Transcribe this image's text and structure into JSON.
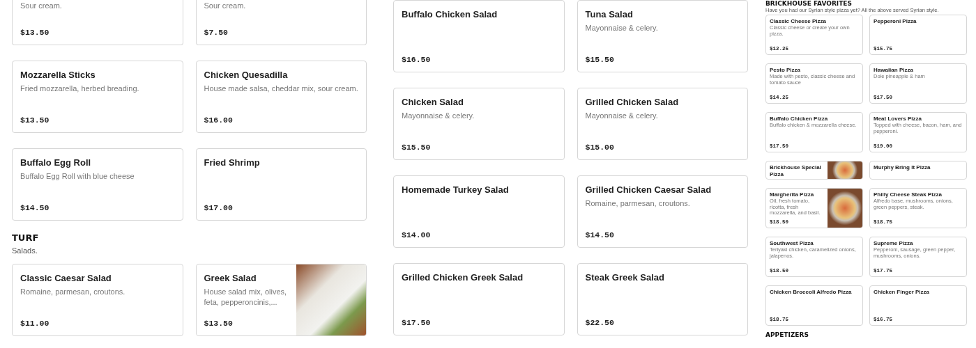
{
  "panels": [
    {
      "blocks": [
        {
          "kind": "grid",
          "items": [
            {
              "kind": "partial",
              "description": "Sour cream.",
              "price": "$13.50"
            },
            {
              "kind": "partial",
              "description": "Sour cream.",
              "price": "$7.50"
            },
            {
              "kind": "full",
              "name": "Mozzarella Sticks",
              "description": "Fried mozzarella, herbed breading.",
              "price": "$13.50"
            },
            {
              "kind": "full",
              "name": "Chicken Quesadilla",
              "description": "House made salsa, cheddar mix, sour cream.",
              "price": "$16.00"
            },
            {
              "kind": "full",
              "name": "Buffalo Egg Roll",
              "description": "Buffalo Egg Roll with blue cheese",
              "price": "$14.50"
            },
            {
              "kind": "full",
              "name": "Fried Shrimp",
              "price": "$17.00"
            }
          ]
        },
        {
          "kind": "heading",
          "title": "TURF",
          "subtitle": "Salads."
        },
        {
          "kind": "grid",
          "items": [
            {
              "kind": "full",
              "name": "Classic Caesar Salad",
              "description": "Romaine, parmesan, croutons.",
              "price": "$11.00"
            },
            {
              "kind": "full",
              "name": "Greek Salad",
              "description": "House salad mix, olives, feta, pepperoncinis,...",
              "price": "$13.50",
              "photo": true
            }
          ]
        }
      ]
    },
    {
      "blocks": [
        {
          "kind": "grid",
          "items": [
            {
              "kind": "full",
              "name": "Buffalo Chicken Salad",
              "price": "$16.50"
            },
            {
              "kind": "full",
              "name": "Tuna Salad",
              "description": "Mayonnaise & celery.",
              "price": "$15.50"
            },
            {
              "kind": "full",
              "name": "Chicken Salad",
              "description": "Mayonnaise & celery.",
              "price": "$15.50"
            },
            {
              "kind": "full",
              "name": "Grilled Chicken Salad",
              "description": "Mayonnaise & celery.",
              "price": "$15.00"
            },
            {
              "kind": "full",
              "name": "Homemade Turkey Salad",
              "price": "$14.00"
            },
            {
              "kind": "full",
              "name": "Grilled Chicken Caesar Salad",
              "description": "Romaine, parmesan, croutons.",
              "price": "$14.50"
            },
            {
              "kind": "full",
              "name": "Grilled Chicken Greek Salad",
              "price": "$17.50"
            },
            {
              "kind": "full",
              "name": "Steak Greek Salad",
              "price": "$22.50"
            }
          ]
        }
      ]
    },
    {
      "blocks": [
        {
          "kind": "heading",
          "title": "BRICKHOUSE FAVORITES",
          "subtitle": "Have you had our Syrian style pizza yet? All the above served Syrian style."
        },
        {
          "kind": "grid",
          "items": [
            {
              "kind": "full",
              "name": "Classic Cheese Pizza",
              "description": "Classic cheese or create your own pizza.",
              "price": "$12.25"
            },
            {
              "kind": "full",
              "name": "Pepperoni Pizza",
              "price": "$15.75"
            },
            {
              "kind": "full",
              "name": "Pesto Pizza",
              "description": "Made with pesto, classic cheese and tomato sauce",
              "price": "$14.25"
            },
            {
              "kind": "full",
              "name": "Hawaiian Pizza",
              "description": "Dole pineapple & ham",
              "price": "$17.50"
            },
            {
              "kind": "full",
              "name": "Buffalo Chicken Pizza",
              "description": "Buffalo chicken & mozzarella cheese.",
              "price": "$17.50"
            },
            {
              "kind": "full",
              "name": "Meat Lovers Pizza",
              "description": "Topped with cheese, bacon, ham, and pepperoni.",
              "price": "$19.00"
            },
            {
              "kind": "short",
              "name": "Brickhouse Special Pizza",
              "photo": true
            },
            {
              "kind": "short",
              "name": "Murphy Bring It Pizza"
            },
            {
              "kind": "full",
              "name": "Margherita Pizza",
              "description": "Oil, fresh tomato, ricotta, fresh mozzarella, and basil.",
              "price": "$18.50",
              "photo": true
            },
            {
              "kind": "full",
              "name": "Philly Cheese Steak Pizza",
              "description": "Alfredo base, mushrooms, onions, green peppers, steak.",
              "price": "$18.75"
            },
            {
              "kind": "full",
              "name": "Southwest Pizza",
              "description": "Teriyaki chicken, caramelized onions, jalapenos.",
              "price": "$18.50"
            },
            {
              "kind": "full",
              "name": "Supreme Pizza",
              "description": "Pepperoni, sausage, green pepper, mushrooms, onions.",
              "price": "$17.75"
            },
            {
              "kind": "full",
              "name": "Chicken Broccoli Alfredo Pizza",
              "price": "$18.75"
            },
            {
              "kind": "full",
              "name": "Chicken Finger Pizza",
              "price": "$16.75"
            }
          ]
        },
        {
          "kind": "heading",
          "title": "APPETIZERS"
        }
      ]
    }
  ]
}
